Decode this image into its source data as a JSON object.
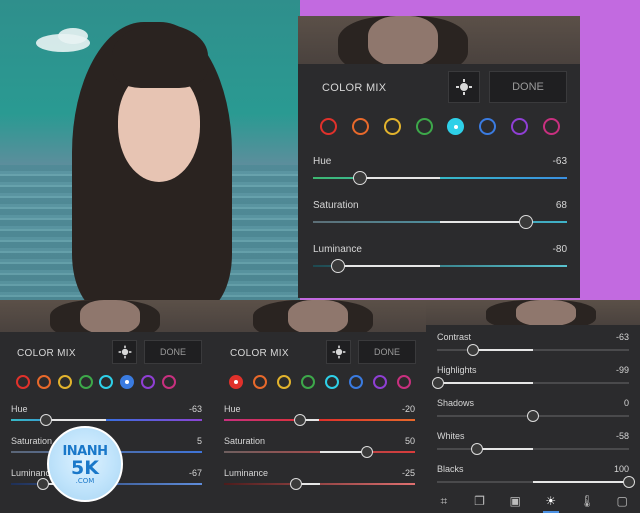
{
  "panels": {
    "main": {
      "title": "COLOR MIX",
      "done": "DONE",
      "colors": [
        "#e0312b",
        "#e8692b",
        "#e2b32d",
        "#3da84a",
        "#2ed0e8",
        "#3a7be0",
        "#8f3fd4",
        "#c8307f"
      ],
      "selected": 4,
      "rows": [
        {
          "label": "Hue",
          "value": "-63",
          "level": 0.185,
          "track": "linear-gradient(90deg,#3db870,#37b9c6 50%,#3a8fe0)"
        },
        {
          "label": "Saturation",
          "value": "68",
          "level": 0.84,
          "track": "linear-gradient(90deg,#5c6e76,#3fb3c9)"
        },
        {
          "label": "Luminance",
          "value": "-80",
          "level": 0.1,
          "track": "linear-gradient(90deg,#1e4950,#59c3cf)"
        }
      ]
    },
    "left": {
      "title": "COLOR MIX",
      "done": "DONE",
      "selected": 5,
      "rows": [
        {
          "label": "Hue",
          "value": "-63",
          "level": 0.185,
          "track": "linear-gradient(90deg,#37b9c6,#3a6fe0 50%,#8b45d4)"
        },
        {
          "label": "Saturation",
          "value": "5",
          "level": 0.525,
          "track": "linear-gradient(90deg,#5b6677,#3f74d9)"
        },
        {
          "label": "Luminance",
          "value": "-67",
          "level": 0.165,
          "track": "linear-gradient(90deg,#1f3057,#5f8ddb)"
        }
      ]
    },
    "middle": {
      "title": "COLOR MIX",
      "done": "DONE",
      "selected": 0,
      "rows": [
        {
          "label": "Hue",
          "value": "-20",
          "level": 0.4,
          "track": "linear-gradient(90deg,#c8307f,#e0312b 50%,#e8692b)"
        },
        {
          "label": "Saturation",
          "value": "50",
          "level": 0.75,
          "track": "linear-gradient(90deg,#6e5f5f,#d93b3b)"
        },
        {
          "label": "Luminance",
          "value": "-25",
          "level": 0.375,
          "track": "linear-gradient(90deg,#4c1c1c,#e07070)"
        }
      ]
    },
    "right": {
      "rows": [
        {
          "label": "Contrast",
          "value": "-63",
          "level": 0.185
        },
        {
          "label": "Highlights",
          "value": "-99",
          "level": 0.005
        },
        {
          "label": "Shadows",
          "value": "0",
          "level": 0.5
        },
        {
          "label": "Whites",
          "value": "-58",
          "level": 0.21
        },
        {
          "label": "Blacks",
          "value": "100",
          "level": 1.0
        }
      ],
      "tools": [
        "crop-icon",
        "layers-icon",
        "image-adjust-icon",
        "light-icon",
        "thermometer-icon",
        "frame-icon"
      ],
      "active_tool": 3
    }
  },
  "watermark": {
    "line1": "INANH",
    "line2": "5K",
    "line3": ".COM"
  }
}
